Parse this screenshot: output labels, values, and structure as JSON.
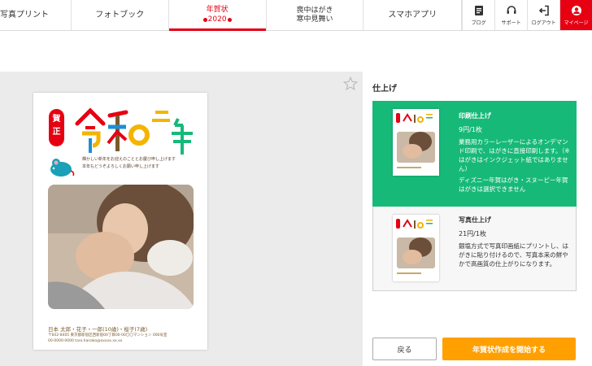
{
  "nav": {
    "tabs": [
      {
        "label": "写真プリント"
      },
      {
        "label": "フォトブック"
      },
      {
        "label_line1": "年賀状",
        "label_line2": "2020"
      },
      {
        "label_line1": "喪中はがき",
        "label_line2": "寒中見舞い"
      },
      {
        "label": "スマホアプリ"
      }
    ],
    "icons": [
      {
        "label": "ブログ",
        "icon": "blog-icon"
      },
      {
        "label": "サポート",
        "icon": "headset-icon"
      },
      {
        "label": "ログアウト",
        "icon": "logout-icon"
      },
      {
        "label": "マイページ",
        "icon": "user-icon"
      }
    ]
  },
  "card": {
    "seal": "賀正",
    "title_chars": [
      "令",
      "和",
      "二",
      "年"
    ],
    "greeting_lines": [
      "輝かしい新年をお迎えのこととお慶び申し上げます",
      "本年もどうぞよろしくお願い申し上げます"
    ],
    "name_line": "日本 太郎・花子・一郎(10歳)・桜子(7歳)",
    "furigana": "ひろし",
    "address_line1": "〒602-8405 東京都新宿区西新宿00丁目00-00〇〇マンション 000号室",
    "address_line2": "00-0000-0000 taro.hanako@xxxxx.xx.xx"
  },
  "panel": {
    "title": "仕上げ",
    "options": [
      {
        "title": "印刷仕上げ",
        "price": "9円/1枚",
        "desc": "業務用カラーレーザーによるオンデマンド印刷で、はがきに直接印刷します。（※はがきはインクジェット紙ではありません）",
        "note": "ディズニー年賀はがき・スヌーピー年賀はがきは選択できません",
        "selected": true
      },
      {
        "title": "写真仕上げ",
        "price": "21円/1枚",
        "desc": "銀塩方式で写真印画紙にプリントし、はがきに貼り付けるので、写真本来の鮮やかで高画質の仕上がりになります。",
        "selected": false
      }
    ]
  },
  "buttons": {
    "back": "戻る",
    "start": "年賀状作成を開始する"
  },
  "colors": {
    "brand_red": "#e60012",
    "selected_green": "#17b978",
    "start_orange": "#ffa000"
  }
}
